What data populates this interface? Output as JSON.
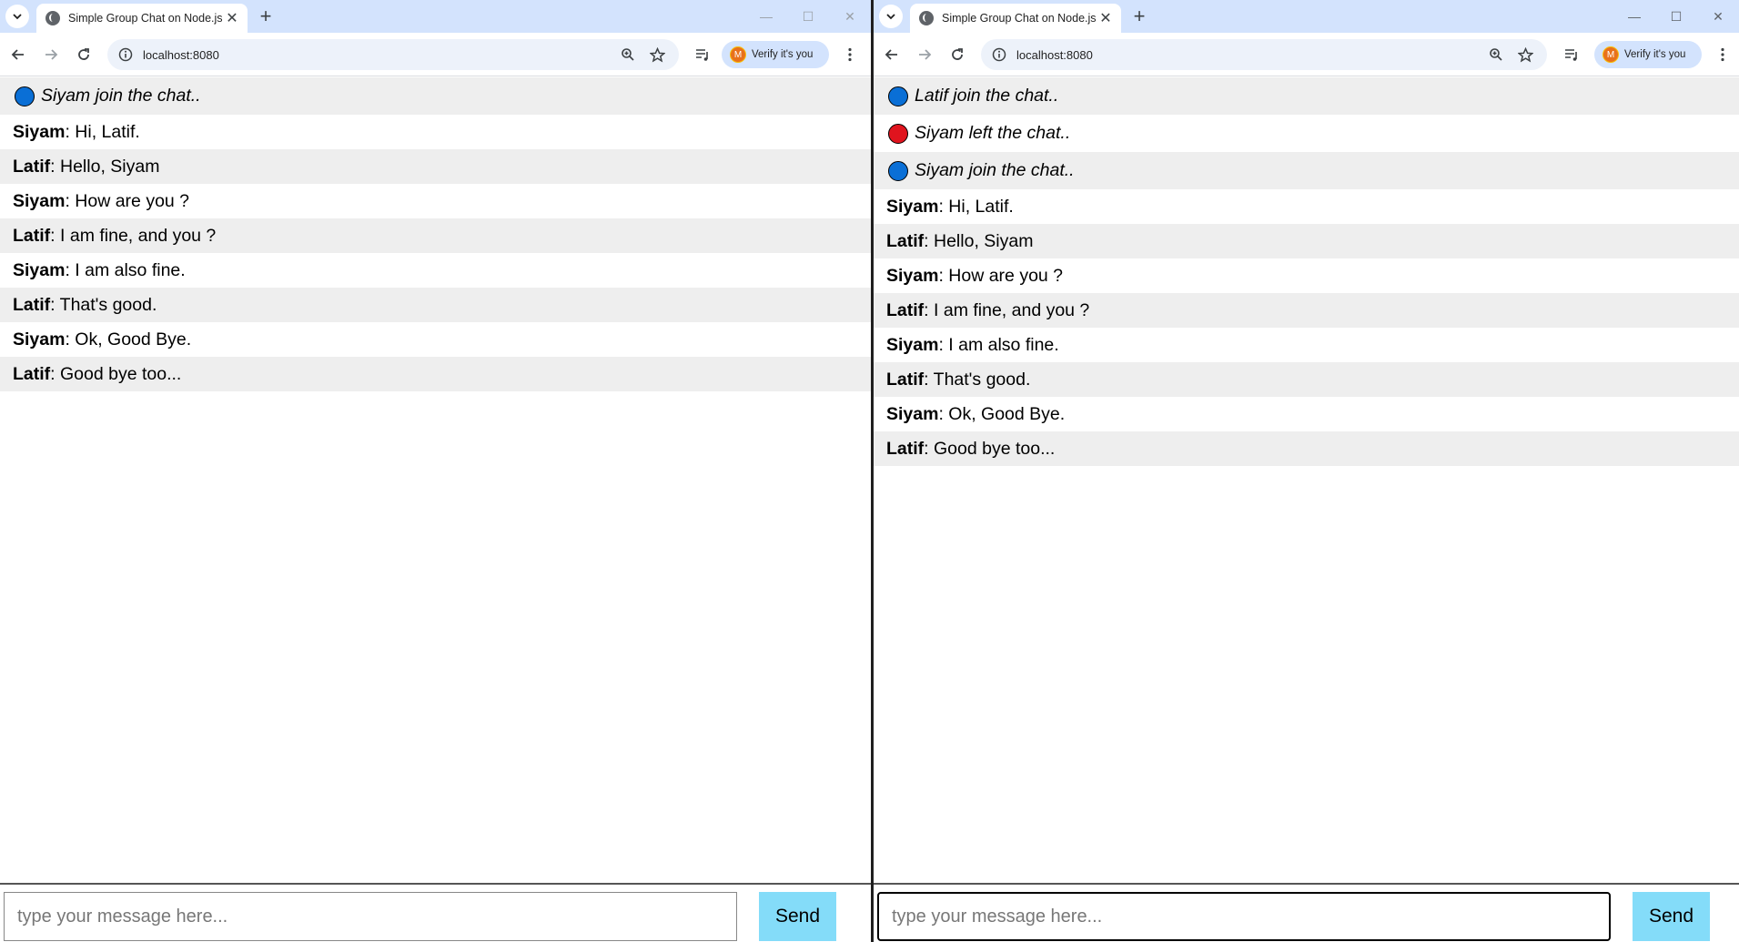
{
  "windows": [
    {
      "tab_title": "Simple Group Chat on Node.js",
      "url": "localhost:8080",
      "profile_label": "Verify it's you",
      "profile_initial": "M",
      "messages": [
        {
          "type": "event",
          "status": "join",
          "text": "Siyam join the chat.."
        },
        {
          "type": "chat",
          "sender": "Siyam",
          "text": ": Hi, Latif."
        },
        {
          "type": "chat",
          "sender": "Latif",
          "text": ": Hello, Siyam"
        },
        {
          "type": "chat",
          "sender": "Siyam",
          "text": ": How are you ?"
        },
        {
          "type": "chat",
          "sender": "Latif",
          "text": ": I am fine, and you ?"
        },
        {
          "type": "chat",
          "sender": "Siyam",
          "text": ": I am also fine."
        },
        {
          "type": "chat",
          "sender": "Latif",
          "text": ": That's good."
        },
        {
          "type": "chat",
          "sender": "Siyam",
          "text": ": Ok, Good Bye."
        },
        {
          "type": "chat",
          "sender": "Latif",
          "text": ": Good bye too..."
        }
      ],
      "input_placeholder": "type your message here...",
      "send_label": "Send"
    },
    {
      "tab_title": "Simple Group Chat on Node.js",
      "url": "localhost:8080",
      "profile_label": "Verify it's you",
      "profile_initial": "M",
      "messages": [
        {
          "type": "event",
          "status": "join",
          "text": "Latif join the chat.."
        },
        {
          "type": "event",
          "status": "leave",
          "text": "Siyam left the chat.."
        },
        {
          "type": "event",
          "status": "join",
          "text": "Siyam join the chat.."
        },
        {
          "type": "chat",
          "sender": "Siyam",
          "text": ": Hi, Latif."
        },
        {
          "type": "chat",
          "sender": "Latif",
          "text": ": Hello, Siyam"
        },
        {
          "type": "chat",
          "sender": "Siyam",
          "text": ": How are you ?"
        },
        {
          "type": "chat",
          "sender": "Latif",
          "text": ": I am fine, and you ?"
        },
        {
          "type": "chat",
          "sender": "Siyam",
          "text": ": I am also fine."
        },
        {
          "type": "chat",
          "sender": "Latif",
          "text": ": That's good."
        },
        {
          "type": "chat",
          "sender": "Siyam",
          "text": ": Ok, Good Bye."
        },
        {
          "type": "chat",
          "sender": "Latif",
          "text": ": Good bye too..."
        }
      ],
      "input_placeholder": "type your message here...",
      "send_label": "Send"
    }
  ],
  "colors": {
    "join_dot": "#0a6fd6",
    "leave_dot": "#e0141e"
  }
}
